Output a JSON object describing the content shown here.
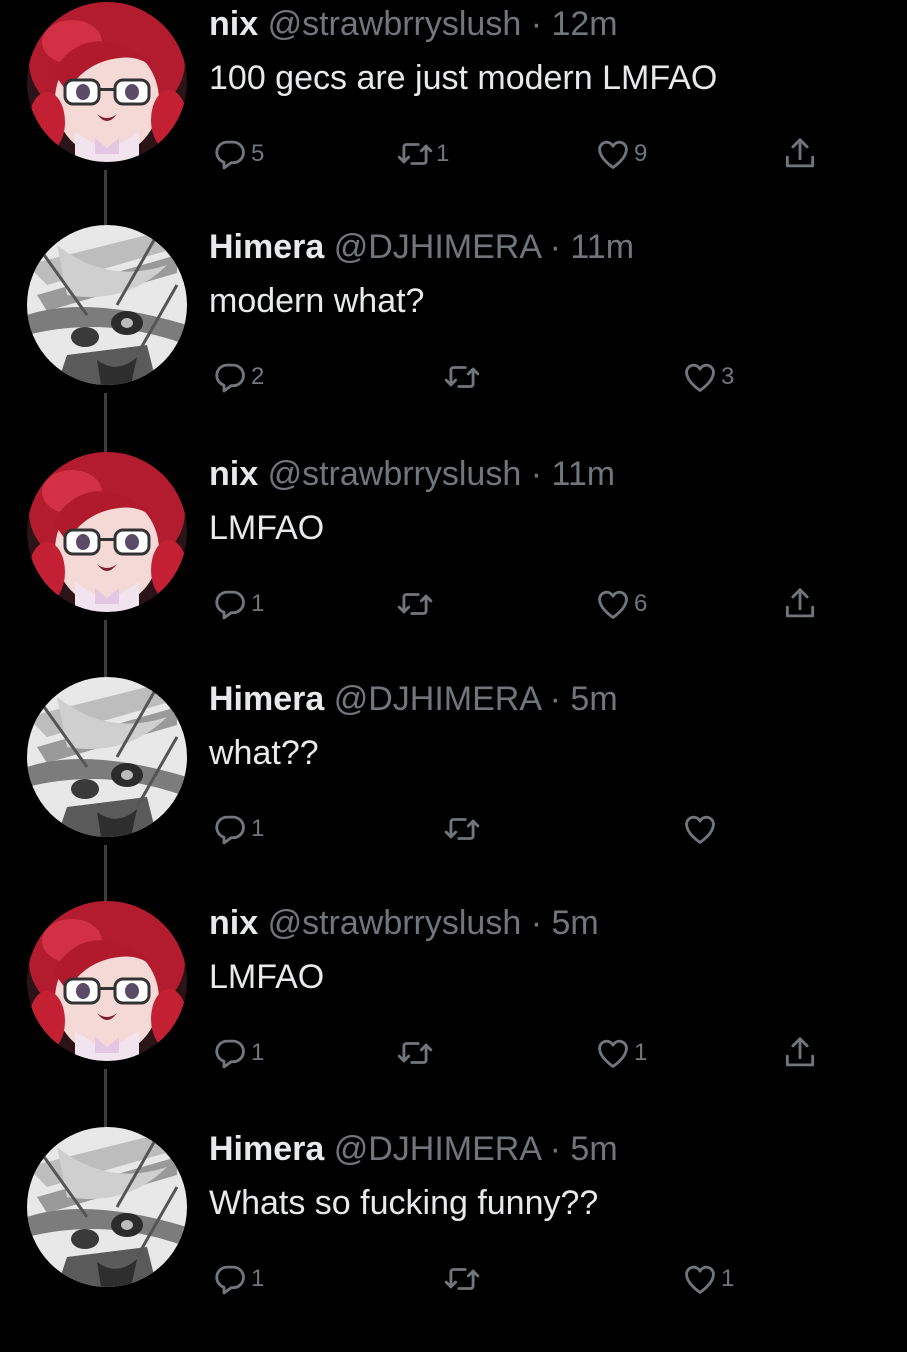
{
  "tweets": [
    {
      "author": "nix",
      "handle": "@strawbrryslush",
      "sep": "·",
      "time": "12m",
      "text": "100 gecs are just modern LMFAO",
      "replies": "5",
      "retweets": "1",
      "likes": "9",
      "has_share": true,
      "avatar": "red-hair-avatar"
    },
    {
      "author": "Himera",
      "handle": "@DJHIMERA",
      "sep": "·",
      "time": "11m",
      "text": "modern what?",
      "replies": "2",
      "retweets": "",
      "likes": "3",
      "has_share": false,
      "avatar": "grayscale-avatar"
    },
    {
      "author": "nix",
      "handle": "@strawbrryslush",
      "sep": "·",
      "time": "11m",
      "text": "LMFAO",
      "replies": "1",
      "retweets": "",
      "likes": "6",
      "has_share": true,
      "avatar": "red-hair-avatar"
    },
    {
      "author": "Himera",
      "handle": "@DJHIMERA",
      "sep": "·",
      "time": "5m",
      "text": "what??",
      "replies": "1",
      "retweets": "",
      "likes": "",
      "has_share": false,
      "avatar": "grayscale-avatar"
    },
    {
      "author": "nix",
      "handle": "@strawbrryslush",
      "sep": "·",
      "time": "5m",
      "text": "LMFAO",
      "replies": "1",
      "retweets": "",
      "likes": "1",
      "has_share": true,
      "avatar": "red-hair-avatar"
    },
    {
      "author": "Himera",
      "handle": "@DJHIMERA",
      "sep": "·",
      "time": "5m",
      "text": "Whats so fucking funny??",
      "replies": "1",
      "retweets": "",
      "likes": "1",
      "has_share": false,
      "avatar": "grayscale-avatar"
    }
  ],
  "colors": {
    "background": "#000000",
    "text": "#e7e9ea",
    "muted": "#71767b",
    "thread_line": "#3a3d40"
  },
  "icons": {
    "reply": "reply-icon",
    "retweet": "retweet-icon",
    "like": "heart-icon",
    "share": "share-icon"
  }
}
